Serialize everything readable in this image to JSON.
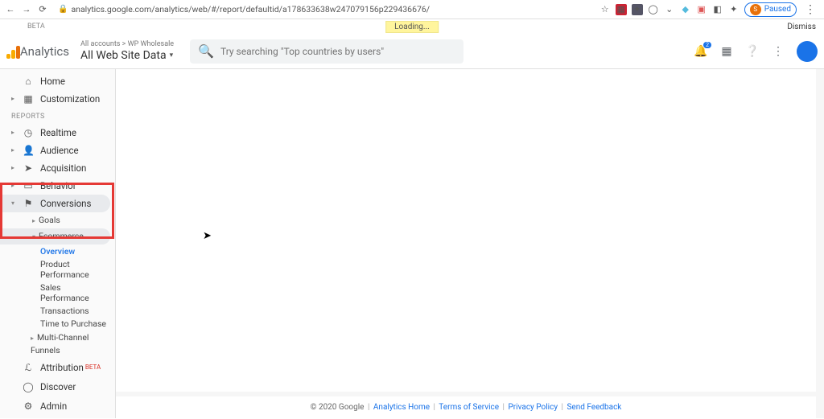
{
  "browser": {
    "url": "analytics.google.com/analytics/web/#/report/defaultid/a178633638w247079156p229436676/",
    "paused_label": "Paused",
    "avatar_letter": "S"
  },
  "meta": {
    "beta_label": "BETA",
    "loading_label": "Loading...",
    "dismiss_label": "Dismiss"
  },
  "header": {
    "product_name": "Analytics",
    "breadcrumb": "All accounts > WP Wholesale",
    "view_name": "All Web Site Data",
    "search_placeholder": "Try searching \"Top countries by users\"",
    "bell_count": "2"
  },
  "sidebar": {
    "home": "Home",
    "customization": "Customization",
    "reports_label": "REPORTS",
    "realtime": "Realtime",
    "audience": "Audience",
    "acquisition": "Acquisition",
    "behavior": "Behavior",
    "conversions": "Conversions",
    "conv_sub": {
      "goals": "Goals",
      "ecommerce": "Ecommerce",
      "ecom": {
        "overview": "Overview",
        "product_perf": "Product Performance",
        "sales_perf": "Sales Performance",
        "transactions": "Transactions",
        "time_purchase": "Time to Purchase"
      },
      "multichannel": "Multi-Channel Funnels"
    },
    "attribution": "Attribution",
    "attribution_badge": "BETA",
    "discover": "Discover",
    "admin": "Admin"
  },
  "footer": {
    "copyright": "© 2020 Google",
    "analytics_home": "Analytics Home",
    "terms": "Terms of Service",
    "privacy": "Privacy Policy",
    "feedback": "Send Feedback"
  }
}
